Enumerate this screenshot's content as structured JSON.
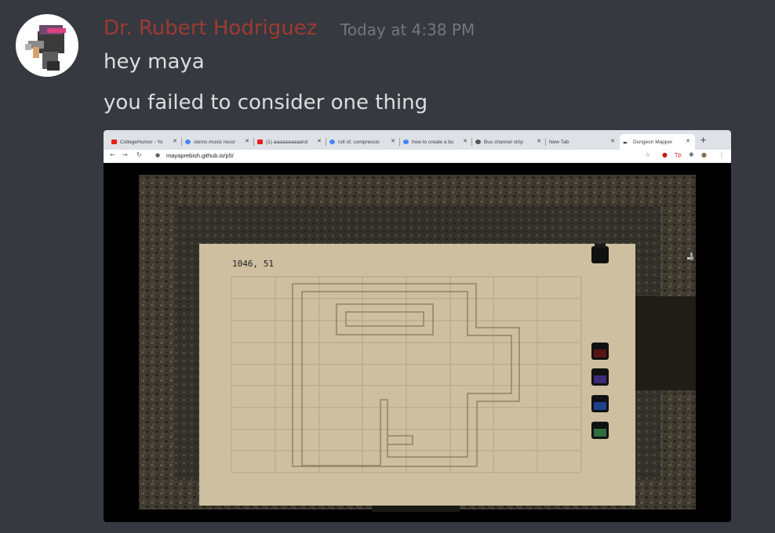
{
  "message": {
    "author": "Dr. Rubert Hodriguez",
    "author_color": "#9c3a32",
    "timestamp": "Today at 4:38 PM",
    "lines": [
      "hey maya",
      "you failed to consider one thing"
    ]
  },
  "browser": {
    "tabs": [
      {
        "title": "CollegeHumor - Yo",
        "icon": "youtube-icon",
        "active": false
      },
      {
        "title": "stems music recor",
        "icon": "google-icon",
        "active": false
      },
      {
        "title": "(1) aaaaaaaaaand",
        "icon": "youtube-icon",
        "active": false
      },
      {
        "title": "roll of. compressio",
        "icon": "google-icon",
        "active": false
      },
      {
        "title": "how to create a bu",
        "icon": "google-icon",
        "active": false
      },
      {
        "title": "Bus channel strip",
        "icon": "apple-icon",
        "active": false
      },
      {
        "title": "New Tab",
        "icon": "",
        "active": false
      },
      {
        "title": "Dungeon Mapper",
        "icon": "feather-icon",
        "active": true
      }
    ],
    "url": "mayaprebish.github.io/p5/"
  },
  "game": {
    "coords": "1046, 51",
    "potions": [
      "black",
      "red",
      "purple",
      "blue",
      "green"
    ],
    "potion_colors": [
      "#111111",
      "#5a1414",
      "#3d2a7a",
      "#1f3f8f",
      "#2f6e43"
    ]
  }
}
